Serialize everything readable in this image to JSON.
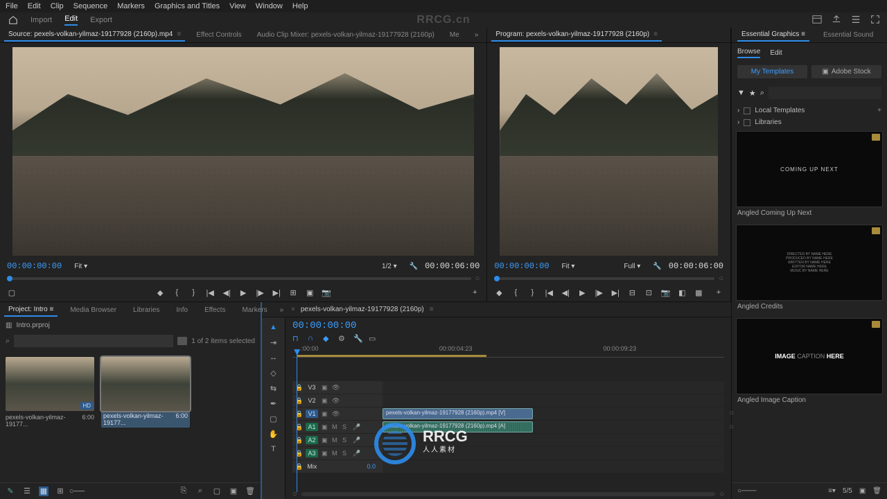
{
  "menubar": [
    "File",
    "Edit",
    "Clip",
    "Sequence",
    "Markers",
    "Graphics and Titles",
    "View",
    "Window",
    "Help"
  ],
  "header": {
    "import": "Import",
    "edit": "Edit",
    "export": "Export",
    "watermark": "RRCG.cn"
  },
  "source": {
    "tabs": {
      "source": "Source: pexels-volkan-yilmaz-19177928 (2160p).mp4",
      "effect_controls": "Effect Controls",
      "audio_mixer": "Audio Clip Mixer: pexels-volkan-yilmaz-19177928 (2160p)",
      "metadata_short": "Me"
    },
    "tc_in": "00:00:00:00",
    "fit": "Fit",
    "zoom_ratio": "1/2",
    "tc_out": "00:00:06:00"
  },
  "program": {
    "title": "Program: pexels-volkan-yilmaz-19177928 (2160p)",
    "tc_in": "00:00:00:00",
    "fit": "Fit",
    "quality": "Full",
    "tc_out": "00:00:06:00"
  },
  "project": {
    "tabs": [
      "Project: Intro",
      "Media Browser",
      "Libraries",
      "Info",
      "Effects",
      "Markers"
    ],
    "file": "Intro.prproj",
    "count": "1 of 2 items selected",
    "items": [
      {
        "name": "pexels-volkan-yilmaz-19177...",
        "dur": "6:00",
        "badge": "HD"
      },
      {
        "name": "pexels-volkan-yilmaz-19177...",
        "dur": "6:00"
      }
    ]
  },
  "timeline": {
    "seq_name": "pexels-volkan-yilmaz-19177928 (2160p)",
    "tc": "00:00:00:00",
    "ruler": [
      {
        "pos": 2,
        "t": ":00:00"
      },
      {
        "pos": 38,
        "t": "00:00:04:23"
      },
      {
        "pos": 78,
        "t": "00:00:09:23"
      }
    ],
    "tracks": {
      "v3": "V3",
      "v2": "V2",
      "v1": "V1",
      "a1": "A1",
      "a2": "A2",
      "a3": "A3",
      "mix": "Mix",
      "mix_db": "0.0"
    },
    "clip_v": "pexels-volkan-yilmaz-19177928 (2160p).mp4 [V]",
    "clip_a": "pexels-volkan-yilmaz-19177928 (2160p).mp4 [A]"
  },
  "essential": {
    "tabs": {
      "graphics": "Essential Graphics",
      "sound": "Essential Sound"
    },
    "subtabs": {
      "browse": "Browse",
      "edit": "Edit"
    },
    "pills": {
      "my": "My Templates",
      "stock": "Adobe Stock"
    },
    "folders": {
      "local": "Local Templates",
      "libs": "Libraries"
    },
    "templates": [
      {
        "name": "Angled Coming Up Next",
        "preview": "COMING UP NEXT"
      },
      {
        "name": "Angled Credits",
        "preview_credits": "DIRECTED BY\\nPRODUCED BY\\nWRITTEN BY"
      },
      {
        "name": "Angled Image Caption",
        "preview_caption_a": "IMAGE ",
        "preview_caption_b": "CAPTION ",
        "preview_caption_c": "HERE"
      }
    ],
    "footer_count": "5/5"
  },
  "watermark": {
    "brand": "RRCG",
    "sub": "人人素材"
  }
}
